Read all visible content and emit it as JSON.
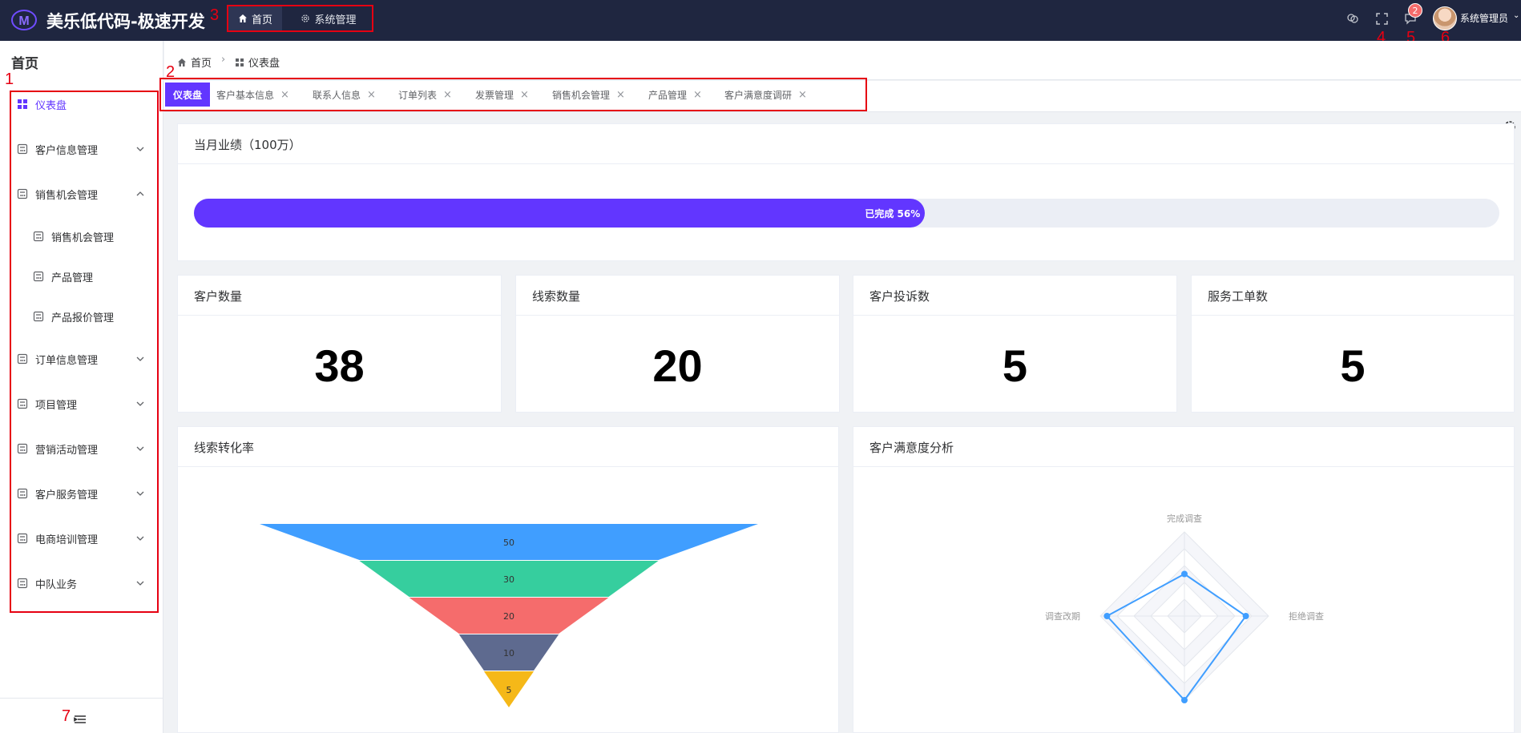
{
  "header": {
    "app_title": "美乐低代码-极速开发",
    "nav": [
      {
        "label": "首页",
        "icon": "home-icon",
        "active": true
      },
      {
        "label": "系统管理",
        "icon": "gear-icon",
        "active": false
      }
    ],
    "notification_count": "2",
    "user_name": "系统管理员",
    "annotations": [
      "3",
      "4",
      "5",
      "6"
    ]
  },
  "sidebar": {
    "title": "首页",
    "items": [
      {
        "label": "仪表盘",
        "icon": "dashboard-icon",
        "active": true,
        "expandable": false
      },
      {
        "label": "客户信息管理",
        "icon": "module-icon",
        "expandable": true,
        "expanded": false
      },
      {
        "label": "销售机会管理",
        "icon": "module-icon",
        "expandable": true,
        "expanded": true
      },
      {
        "label": "销售机会管理",
        "icon": "module-icon",
        "sub": true
      },
      {
        "label": "产品管理",
        "icon": "module-icon",
        "sub": true
      },
      {
        "label": "产品报价管理",
        "icon": "module-icon",
        "sub": true
      },
      {
        "label": "订单信息管理",
        "icon": "module-icon",
        "expandable": true,
        "expanded": false
      },
      {
        "label": "项目管理",
        "icon": "module-icon",
        "expandable": true,
        "expanded": false
      },
      {
        "label": "营销活动管理",
        "icon": "module-icon",
        "expandable": true,
        "expanded": false
      },
      {
        "label": "客户服务管理",
        "icon": "module-icon",
        "expandable": true,
        "expanded": false
      },
      {
        "label": "电商培训管理",
        "icon": "module-icon",
        "expandable": true,
        "expanded": false
      },
      {
        "label": "中队业务",
        "icon": "module-icon",
        "expandable": true,
        "expanded": false
      }
    ],
    "annotations": [
      "1",
      "7"
    ]
  },
  "breadcrumb": [
    {
      "label": "首页",
      "icon": "home-icon"
    },
    {
      "label": "仪表盘",
      "icon": "dashboard-icon"
    }
  ],
  "tabs": {
    "annotation": "2",
    "items": [
      {
        "label": "仪表盘",
        "active": true,
        "closable": false
      },
      {
        "label": "客户基本信息",
        "closable": true
      },
      {
        "label": "联系人信息",
        "closable": true
      },
      {
        "label": "订单列表",
        "closable": true
      },
      {
        "label": "发票管理",
        "closable": true
      },
      {
        "label": "销售机会管理",
        "closable": true
      },
      {
        "label": "产品管理",
        "closable": true
      },
      {
        "label": "客户满意度调研",
        "closable": true
      }
    ],
    "close_glyph": "×"
  },
  "performance": {
    "title": "当月业绩（100万）",
    "progress_percent": 56,
    "progress_label": "已完成 56%"
  },
  "stats": [
    {
      "title": "客户数量",
      "value": "38"
    },
    {
      "title": "线索数量",
      "value": "20"
    },
    {
      "title": "客户投诉数",
      "value": "5"
    },
    {
      "title": "服务工单数",
      "value": "5"
    }
  ],
  "colors": {
    "accent": "#6236ff",
    "topbar": "#1f2640",
    "annotation": "#e60012"
  },
  "chart_data": [
    {
      "type": "funnel",
      "title": "线索转化率",
      "categories": [
        "",
        "",
        "",
        "",
        ""
      ],
      "values": [
        50,
        30,
        20,
        10,
        5
      ],
      "colors": [
        "#409eff",
        "#36ce9e",
        "#f56c6c",
        "#5e6a8f",
        "#f5b818"
      ]
    },
    {
      "type": "radar",
      "title": "客户满意度分析",
      "indicators": [
        "完成调查",
        "拒绝调查",
        "",
        "调查改期"
      ],
      "series": [
        {
          "values": [
            0.5,
            0.73,
            1.0,
            0.92
          ]
        }
      ],
      "color": "#409eff"
    }
  ]
}
